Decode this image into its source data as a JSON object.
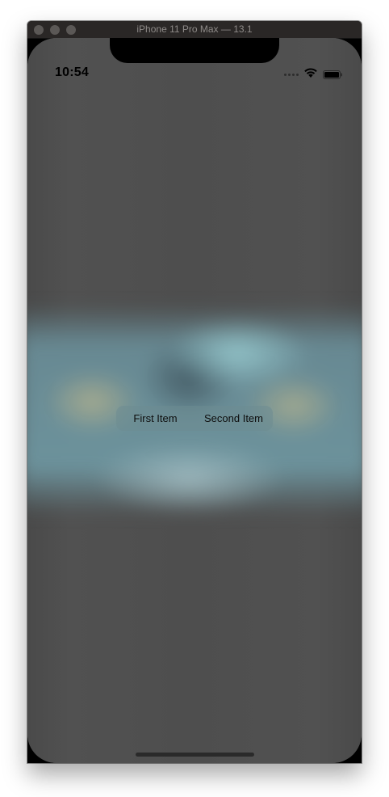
{
  "window": {
    "title": "iPhone 11 Pro Max — 13.1"
  },
  "status_bar": {
    "time": "10:54",
    "icons": [
      "signal-icon",
      "wifi-icon",
      "battery-icon"
    ]
  },
  "segmented_control": {
    "items": [
      {
        "label": "First Item"
      },
      {
        "label": "Second Item"
      }
    ]
  },
  "colors": {
    "screen_background": "#4f4f4f",
    "titlebar": "#2a2726",
    "blur_tint": "#6e9aa2"
  }
}
